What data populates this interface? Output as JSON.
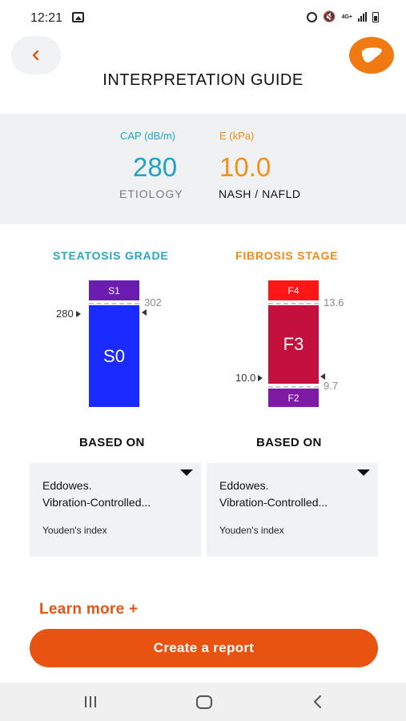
{
  "status_bar": {
    "time": "12:21",
    "network": "4G+"
  },
  "header": {
    "title": "INTERPRETATION GUIDE",
    "back_icon": "chevron-left-icon",
    "logo_icon": "liver-logo-icon"
  },
  "summary": {
    "cap_label": "CAP (dB/m)",
    "cap_value": "280",
    "e_label": "E (kPa)",
    "e_value": "10.0",
    "etiology_label": "ETIOLOGY",
    "etiology_value": "NASH / NAFLD"
  },
  "steatosis": {
    "title": "STEATOSIS GRADE",
    "upper_grade": "S1",
    "current_grade": "S0",
    "threshold": "302",
    "measurement": "280",
    "based_on_title": "BASED ON",
    "reference_line1": "Eddowes.",
    "reference_line2": "Vibration-Controlled...",
    "method": "Youden's index"
  },
  "fibrosis": {
    "title": "FIBROSIS STAGE",
    "upper_stage": "F4",
    "current_stage": "F3",
    "lower_stage": "F2",
    "upper_threshold": "13.6",
    "lower_threshold": "9.7",
    "measurement": "10.0",
    "based_on_title": "BASED ON",
    "reference_line1": "Eddowes.",
    "reference_line2": "Vibration-Controlled...",
    "method": "Youden's index"
  },
  "footer": {
    "learn_more": "Learn more +",
    "create_report": "Create a report"
  },
  "colors": {
    "accent": "#e8540f",
    "cap": "#1fa3bf",
    "e": "#f0901f"
  }
}
